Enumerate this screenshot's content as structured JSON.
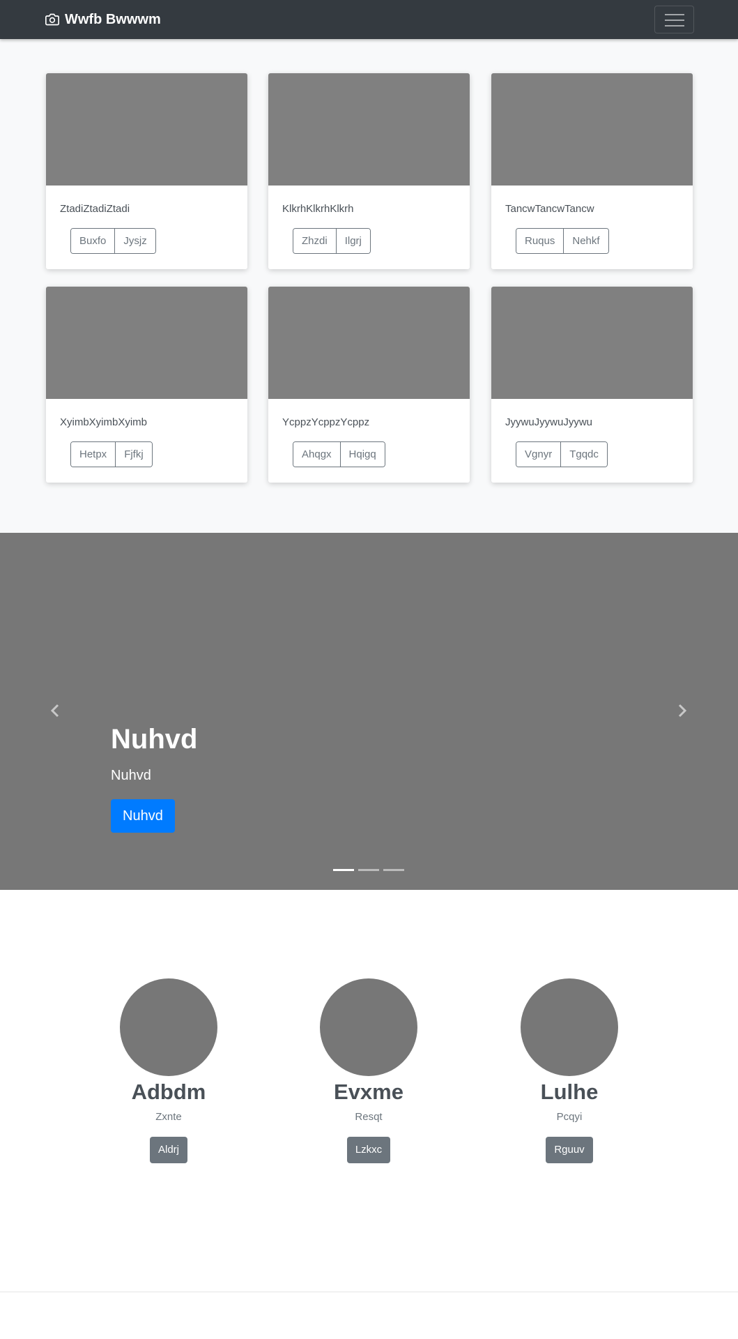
{
  "navbar": {
    "brand": "Wwfb Bwwwm",
    "brand_icon": "camera-icon",
    "toggler_icon": "hamburger-menu-icon"
  },
  "album": {
    "cards": [
      {
        "text": "ZtadiZtadiZtadi",
        "buttons": [
          "Buxfo",
          "Jysjz"
        ]
      },
      {
        "text": "KlkrhKlkrhKlkrh",
        "buttons": [
          "Zhzdi",
          "Ilgrj"
        ]
      },
      {
        "text": "TancwTancwTancw",
        "buttons": [
          "Ruqus",
          "Nehkf"
        ]
      },
      {
        "text": "XyimbXyimbXyimb",
        "buttons": [
          "Hetpx",
          "Fjfkj"
        ]
      },
      {
        "text": "YcppzYcppzYcppz",
        "buttons": [
          "Ahqgx",
          "Hqigq"
        ]
      },
      {
        "text": "JyywuJyywuJyywu",
        "buttons": [
          "Vgnyr",
          "Tgqdc"
        ]
      }
    ]
  },
  "carousel": {
    "title": "Nuhvd",
    "subtitle": "Nuhvd",
    "button": "Nuhvd",
    "slide_count": 3,
    "active_slide": 1,
    "prev_icon": "chevron-left-icon",
    "next_icon": "chevron-right-icon"
  },
  "marketing": {
    "columns": [
      {
        "name": "Adbdm",
        "subtitle": "Zxnte",
        "button": "Aldrj"
      },
      {
        "name": "Evxme",
        "subtitle": "Resqt",
        "button": "Lzkxc"
      },
      {
        "name": "Lulhe",
        "subtitle": "Pcqyi",
        "button": "Rguuv"
      }
    ]
  },
  "colors": {
    "navbar_bg": "#343a40",
    "primary": "#007bff",
    "secondary": "#6c757d",
    "placeholder": "#808080"
  }
}
